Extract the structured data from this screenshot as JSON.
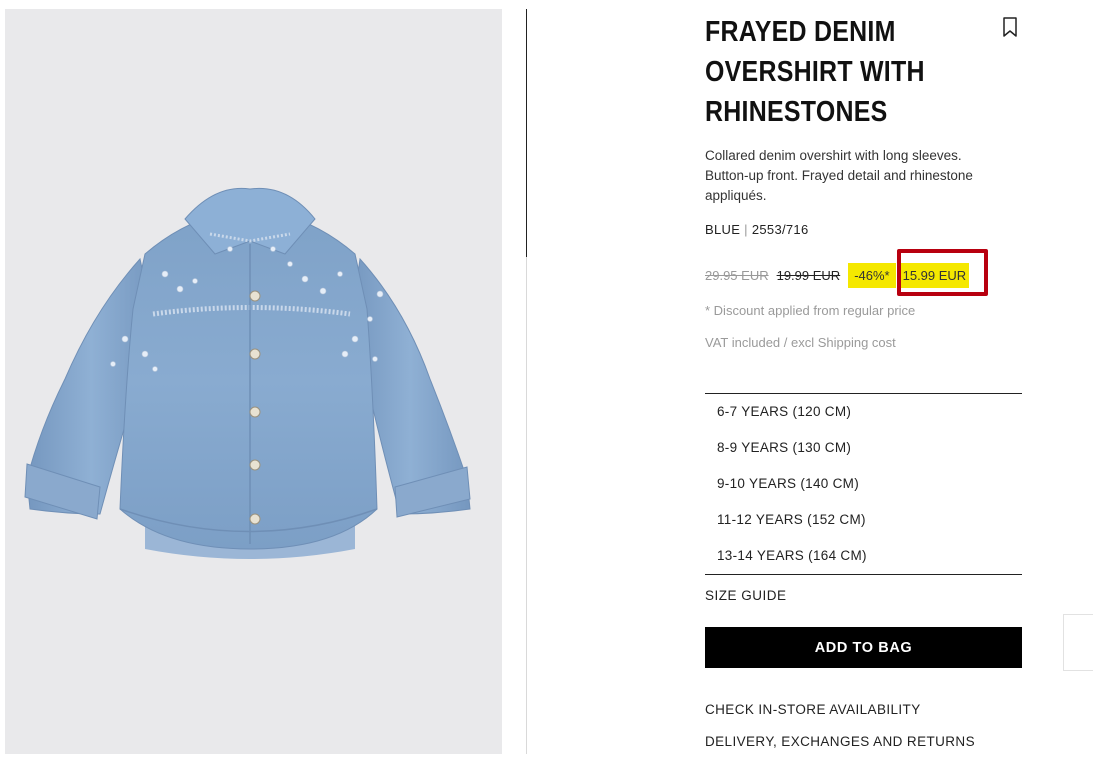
{
  "product": {
    "title": "FRAYED DENIM OVERSHIRT WITH RHINESTONES",
    "description": "Collared denim overshirt with long sleeves. Button-up front. Frayed detail and rhinestone appliqués.",
    "color": "BLUE",
    "reference": "2553/716"
  },
  "price": {
    "original": "29.95 EUR",
    "previous": "19.99 EUR",
    "discount_badge": "-46%*",
    "current": "15.99 EUR",
    "discount_note": "* Discount applied from regular price",
    "vat_note": "VAT included / excl Shipping cost"
  },
  "sizes": [
    "6-7 YEARS (120 CM)",
    "8-9 YEARS (130 CM)",
    "9-10 YEARS (140 CM)",
    "11-12 YEARS (152 CM)",
    "13-14 YEARS (164 CM)"
  ],
  "actions": {
    "size_guide": "SIZE GUIDE",
    "add_to_bag": "ADD TO BAG",
    "store_availability": "CHECK IN-STORE AVAILABILITY",
    "delivery": "DELIVERY, EXCHANGES AND RETURNS"
  },
  "icons": {
    "bookmark": "bookmark-icon"
  },
  "colors": {
    "highlight": "#f5e800",
    "annotation_box": "#b8000f",
    "button_bg": "#000000"
  }
}
